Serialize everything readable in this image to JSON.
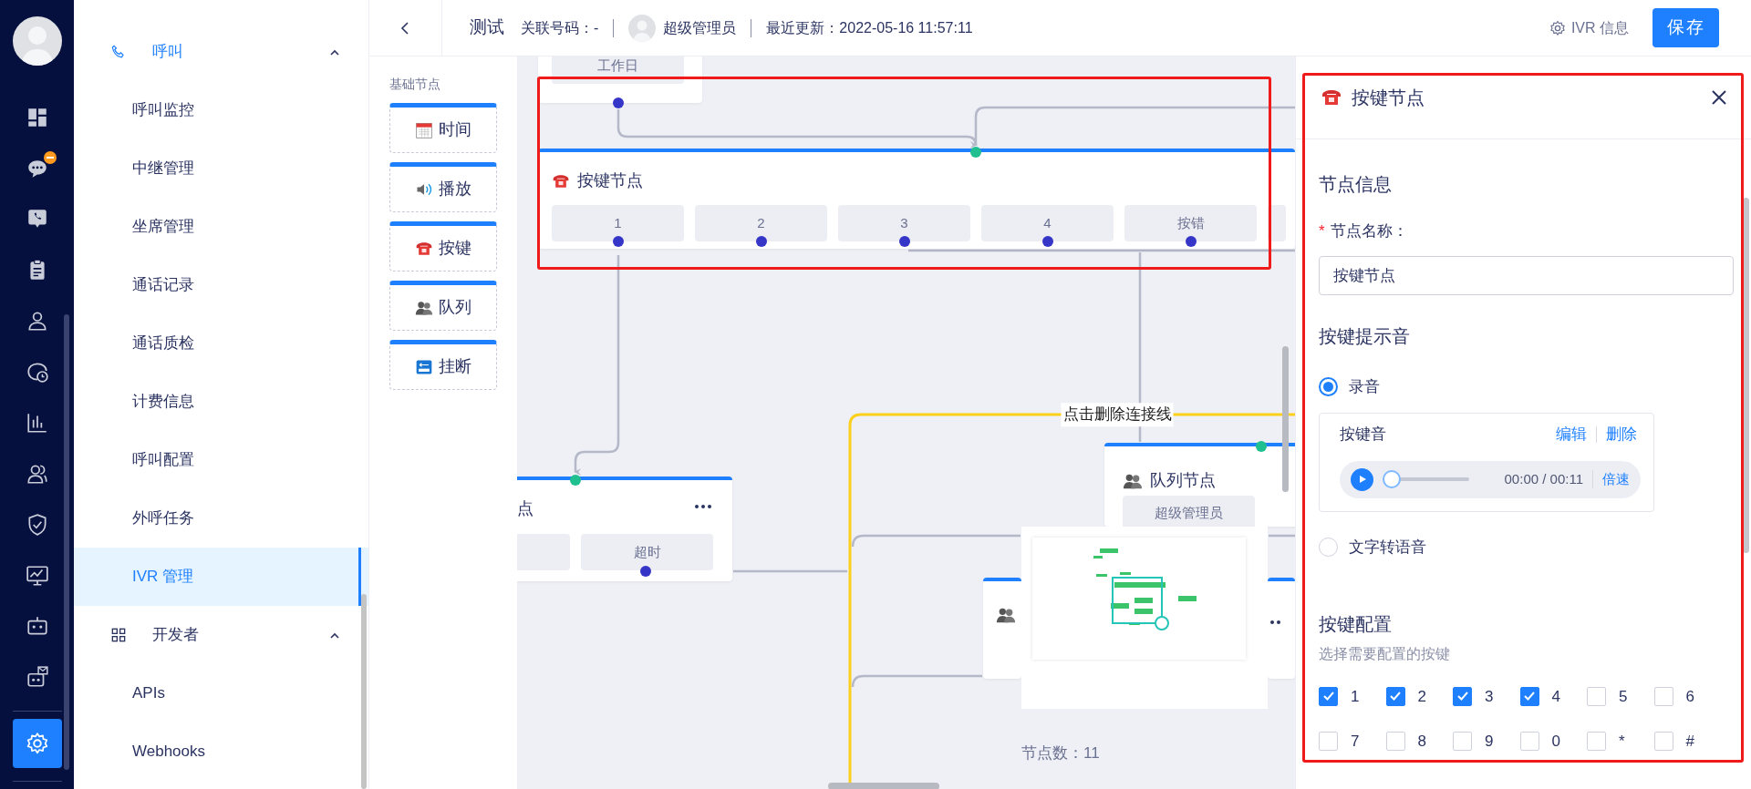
{
  "rail": [
    {
      "selected": false,
      "badge": false
    },
    {
      "selected": false,
      "badge": true
    },
    {
      "selected": false,
      "badge": false
    },
    {
      "selected": false,
      "badge": false
    },
    {
      "selected": false,
      "badge": false
    },
    {
      "selected": false,
      "badge": false
    },
    {
      "selected": false,
      "badge": false
    },
    {
      "selected": false,
      "badge": false
    },
    {
      "selected": false,
      "badge": false
    },
    {
      "selected": false,
      "badge": false
    },
    {
      "selected": false,
      "badge": false
    },
    {
      "selected": false,
      "badge": false
    },
    {
      "selected": true,
      "badge": false
    }
  ],
  "sidebar": {
    "groups": [
      {
        "label": "呼叫",
        "expanded": true,
        "children": [
          {
            "label": "呼叫监控",
            "selected": false
          },
          {
            "label": "中继管理",
            "selected": false
          },
          {
            "label": "坐席管理",
            "selected": false
          },
          {
            "label": "通话记录",
            "selected": false
          },
          {
            "label": "通话质检",
            "selected": false
          },
          {
            "label": "计费信息",
            "selected": false
          },
          {
            "label": "呼叫配置",
            "selected": false
          },
          {
            "label": "外呼任务",
            "selected": false
          },
          {
            "label": "IVR 管理",
            "selected": true
          }
        ]
      },
      {
        "label": "开发者",
        "expanded": true,
        "children": [
          {
            "label": "APIs",
            "selected": false
          },
          {
            "label": "Webhooks",
            "selected": false
          }
        ]
      }
    ]
  },
  "header": {
    "title": "测试",
    "relation": "关联号码：-",
    "user": "超级管理员",
    "updated": "最近更新：2022-05-16 11:57:11",
    "info": "IVR 信息",
    "save": "保存"
  },
  "palette": {
    "title": "基础节点",
    "items": [
      {
        "label": "时间"
      },
      {
        "label": "播放"
      },
      {
        "label": "按键"
      },
      {
        "label": "队列"
      },
      {
        "label": "挂断"
      }
    ]
  },
  "canvas": {
    "top_node": {
      "branches": [
        "工作日"
      ]
    },
    "key_node": {
      "title": "按键节点",
      "branches": [
        "1",
        "2",
        "3",
        "4",
        "按错"
      ]
    },
    "left_node": {
      "title": "点",
      "branches": [
        "超时"
      ]
    },
    "queue_node": {
      "title": "队列节点",
      "branches": [
        "超级管理员"
      ]
    },
    "edge_label": "点击删除连接线",
    "node_count": "节点数：11"
  },
  "panel": {
    "title": "按键节点",
    "info_title": "节点信息",
    "name_label": "节点名称：",
    "required": true,
    "name_value": "按键节点",
    "prompt_title": "按键提示音",
    "prompt_options": [
      {
        "label": "录音",
        "selected": true
      },
      {
        "label": "文字转语音",
        "selected": false
      }
    ],
    "recording": {
      "name": "按键音",
      "edit": "编辑",
      "delete": "删除",
      "time": "00:00 / 00:11",
      "speed": "倍速",
      "level": 0
    },
    "keys_title": "按键配置",
    "keys_hint": "选择需要配置的按键",
    "keys": [
      {
        "label": "1",
        "checked": true
      },
      {
        "label": "2",
        "checked": true
      },
      {
        "label": "3",
        "checked": true
      },
      {
        "label": "4",
        "checked": true
      },
      {
        "label": "5",
        "checked": false
      },
      {
        "label": "6",
        "checked": false
      },
      {
        "label": "7",
        "checked": false
      },
      {
        "label": "8",
        "checked": false
      },
      {
        "label": "9",
        "checked": false
      },
      {
        "label": "0",
        "checked": false
      },
      {
        "label": "*",
        "checked": false
      },
      {
        "label": "#",
        "checked": false
      }
    ]
  }
}
